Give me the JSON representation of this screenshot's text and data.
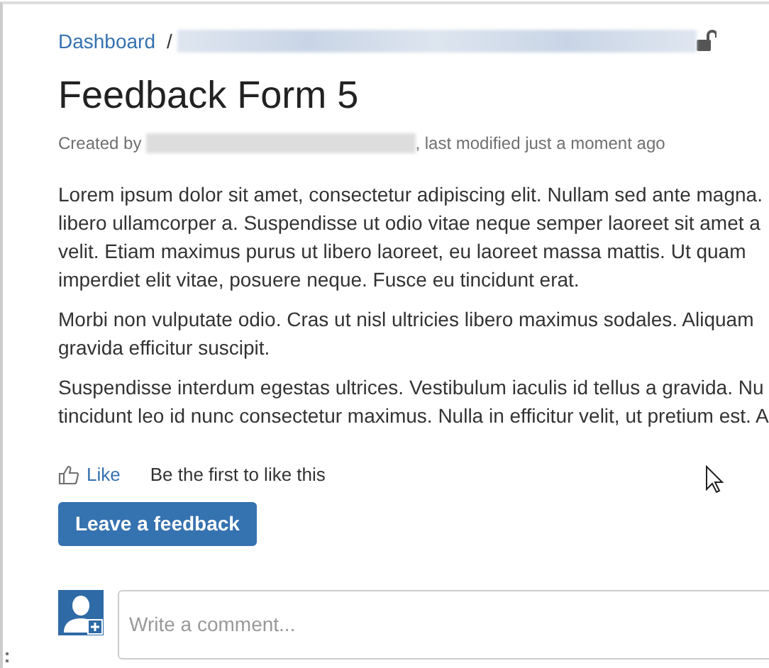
{
  "breadcrumb": {
    "link": "Dashboard",
    "separator": "/"
  },
  "title": "Feedback Form 5",
  "byline": {
    "prefix": "Created by",
    "suffix": ", last modified just a moment ago"
  },
  "paragraphs": [
    {
      "lines": [
        "Lorem ipsum dolor sit amet, consectetur adipiscing elit. Nullam sed ante magna.",
        "libero ullamcorper a. Suspendisse ut odio vitae neque semper laoreet sit amet a",
        "velit. Etiam maximus purus ut libero laoreet, eu laoreet massa mattis. Ut quam",
        "imperdiet elit vitae, posuere neque. Fusce eu tincidunt erat."
      ]
    },
    {
      "lines": [
        "Morbi non vulputate odio. Cras ut nisl ultricies libero maximus sodales. Aliquam",
        "gravida efficitur suscipit."
      ]
    },
    {
      "lines": [
        "Suspendisse interdum egestas ultrices. Vestibulum iaculis id tellus a gravida. Nu",
        "tincidunt leo id nunc consectetur maximus. Nulla in efficitur velit, ut pretium est. A"
      ]
    }
  ],
  "like": {
    "label": "Like",
    "note": "Be the first to like this"
  },
  "feedback_button": "Leave a feedback",
  "comment": {
    "placeholder": "Write a comment..."
  }
}
